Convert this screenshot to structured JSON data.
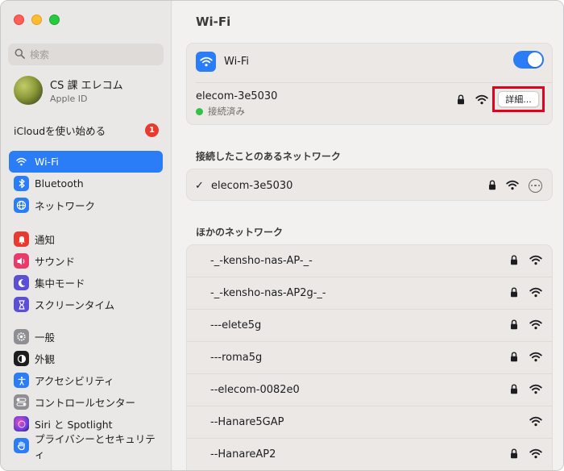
{
  "sidebar": {
    "search_placeholder": "検索",
    "profile": {
      "name": "CS 課 エレコム",
      "subtitle": "Apple ID"
    },
    "icloud": {
      "label": "iCloudを使い始める",
      "badge": "1"
    },
    "items": [
      {
        "label": "Wi-Fi",
        "icon": "wifi-icon",
        "color": "#2a7df7"
      },
      {
        "label": "Bluetooth",
        "icon": "bluetooth-icon",
        "color": "#2a7df7"
      },
      {
        "label": "ネットワーク",
        "icon": "globe-icon",
        "color": "#2a7df7"
      },
      {
        "label": "通知",
        "icon": "bell-icon",
        "color": "#ea3a30"
      },
      {
        "label": "サウンド",
        "icon": "speaker-icon",
        "color": "#ea3a6a"
      },
      {
        "label": "集中モード",
        "icon": "moon-icon",
        "color": "#5b4fd6"
      },
      {
        "label": "スクリーンタイム",
        "icon": "hourglass-icon",
        "color": "#5b4fd6"
      },
      {
        "label": "一般",
        "icon": "gear-icon",
        "color": "#8e8e93"
      },
      {
        "label": "外観",
        "icon": "appearance-icon",
        "color": "#1d1d1f"
      },
      {
        "label": "アクセシビリティ",
        "icon": "accessibility-icon",
        "color": "#2a7df7"
      },
      {
        "label": "コントロールセンター",
        "icon": "control-center-icon",
        "color": "#8e8e93"
      },
      {
        "label": "Siri と Spotlight",
        "icon": "siri-icon",
        "color": "#9b3fd6"
      },
      {
        "label": "プライバシーとセキュリティ",
        "icon": "hand-icon",
        "color": "#2a7df7"
      }
    ]
  },
  "main": {
    "title": "Wi-Fi",
    "wifi_label": "Wi-Fi",
    "wifi_enabled": true,
    "current_network": {
      "ssid": "elecom-3e5030",
      "status": "接続済み"
    },
    "details_button": "詳細...",
    "known_title": "接続したことのあるネットワーク",
    "known_networks": [
      {
        "ssid": "elecom-3e5030",
        "secured": true
      }
    ],
    "other_title": "ほかのネットワーク",
    "other_networks": [
      {
        "ssid": "-_-kensho-nas-AP-_-",
        "secured": true
      },
      {
        "ssid": "-_-kensho-nas-AP2g-_-",
        "secured": true
      },
      {
        "ssid": "---elete5g",
        "secured": true
      },
      {
        "ssid": "---roma5g",
        "secured": true
      },
      {
        "ssid": "--elecom-0082e0",
        "secured": true
      },
      {
        "ssid": "--Hanare5GAP",
        "secured": false
      },
      {
        "ssid": "--HanareAP2",
        "secured": true
      }
    ]
  }
}
